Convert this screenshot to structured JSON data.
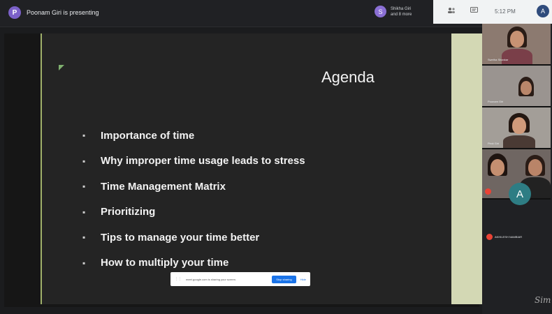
{
  "presenter": {
    "initial": "P",
    "text": "Poonam Giri is presenting"
  },
  "meeting_chip": {
    "initial": "S",
    "line1": "Shikha Giri",
    "line2": "and 8 more"
  },
  "top_controls": {
    "people_icon": "people-icon",
    "chat_icon": "chat-icon",
    "time": "5:12 PM",
    "user_initial": "A"
  },
  "slide": {
    "title": "Agenda",
    "items": [
      "Importance of time",
      "Why improper time usage leads to stress",
      "Time Management Matrix",
      "Prioritizing",
      "Tips to manage your time better",
      "How to multiply your time"
    ],
    "bullet": "▪"
  },
  "share_bar": {
    "text": "meet.google.com is sharing your screen.",
    "stop_label": "Stop sharing",
    "hide_label": "Hide"
  },
  "participants": [
    {
      "name": "Swetha Shankar"
    },
    {
      "name": "Poonam Giri"
    },
    {
      "name": "Pinki Giri"
    },
    {
      "name": ""
    }
  ],
  "avatar_participant": {
    "initial": "A",
    "name": "AKHILESH NAMBIAR"
  },
  "signature": "Sim"
}
